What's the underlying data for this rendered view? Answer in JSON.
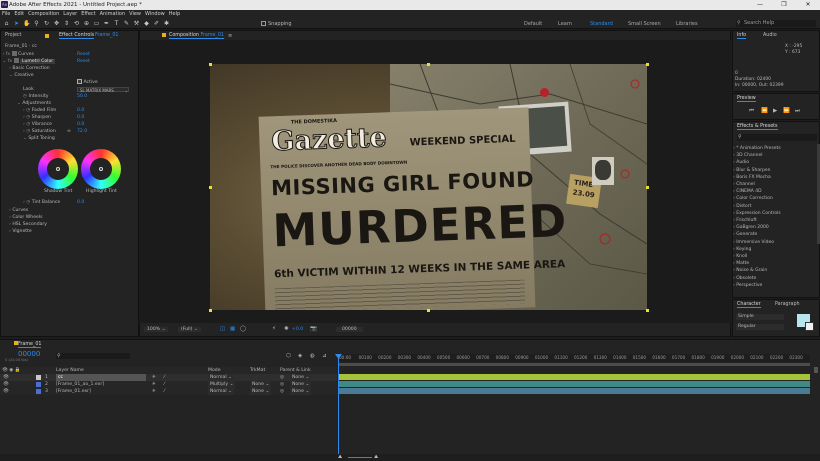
{
  "window": {
    "title": "Adobe After Effects 2021 - Untitled Project.aep *",
    "controls": [
      "—",
      "❐",
      "✕"
    ]
  },
  "menu": [
    "File",
    "Edit",
    "Composition",
    "Layer",
    "Effect",
    "Animation",
    "View",
    "Window",
    "Help"
  ],
  "toolbar": {
    "snapping_label": "Snapping",
    "workspaces": [
      "Default",
      "Learn",
      "Standard",
      "Small Screen",
      "Libraries"
    ],
    "active_workspace": "Standard",
    "search_placeholder": "Search Help"
  },
  "left_panel": {
    "tabs": [
      "Project",
      "Effect Controls"
    ],
    "effect_controls_target": "Frame_01",
    "comp_path": "Frame_01 · cc",
    "effects": [
      {
        "name": "Curves",
        "reset": "Reset"
      },
      {
        "name": "Lumetri Color",
        "reset": "Reset"
      }
    ],
    "sections": {
      "basic_correction": "Basic Correction",
      "creative": "Creative",
      "active_label": "Active",
      "look_label": "Look",
      "look_value": "SL MATRIX MARS",
      "intensity_label": "Intensity",
      "intensity_value": "50.0",
      "adjustments": "Adjustments",
      "faded_film_label": "Faded Film",
      "faded_film_value": "0.0",
      "sharpen_label": "Sharpen",
      "sharpen_value": "0.0",
      "vibrance_label": "Vibrance",
      "vibrance_value": "0.0",
      "saturation_label": "Saturation",
      "saturation_value": "72.0",
      "split_toning": "Split Toning",
      "shadow_tint": "Shadow Tint",
      "highlight_tint": "Highlight Tint",
      "tint_balance_label": "Tint Balance",
      "tint_balance_value": "0.0",
      "curves": "Curves",
      "color_wheels": "Color Wheels",
      "hsl_secondary": "HSL Secondary",
      "vignette": "Vignette"
    }
  },
  "composition": {
    "tab_label": "Composition",
    "tab_name": "Frame_01",
    "sub_tab": "Frame_01",
    "adaptive_resolution": "Adaptive Resolution (1/2)",
    "footer": {
      "zoom": "100%",
      "resolution": "(Full)",
      "exposure": "+0.0",
      "timecode": "00000"
    },
    "newspaper": {
      "masthead_small": "THE DOMESTIKA",
      "masthead": "Gazette",
      "weekend": "WEEKEND SPECIAL",
      "subhead": "THE POLICE DISCOVER ANOTHER DEAD BODY DOWNTOWN",
      "headline1": "MISSING GIRL FOUND",
      "headline2": "MURDERED",
      "footline": "6th VICTIM WITHIN 12 WEEKS IN THE SAME AREA",
      "note_time": "TIME",
      "note_date": "23.09"
    }
  },
  "info_panel": {
    "tabs": [
      "Info",
      "Audio"
    ],
    "x": "X : -295",
    "y": "Y : 673",
    "duration": "Duration: 02400",
    "in_out": "In: 00000, Out: 02399",
    "zero": "0"
  },
  "preview_panel": {
    "title": "Preview"
  },
  "effects_presets": {
    "title": "Effects & Presets",
    "search_placeholder": "",
    "items": [
      "* Animation Presets",
      "3D Channel",
      "Audio",
      "Blur & Sharpen",
      "Boris FX Mocha",
      "Channel",
      "CINEMA 4D",
      "Color Correction",
      "Distort",
      "Expression Controls",
      "Frischluft",
      "GaBgren 2000",
      "Generate",
      "Immersive Video",
      "Keying",
      "Knoll",
      "Matte",
      "Noise & Grain",
      "Obsolete",
      "Perspective"
    ]
  },
  "character_panel": {
    "tabs": [
      "Character",
      "Paragraph"
    ],
    "font_family": "Simple",
    "font_style": "Regular",
    "fill_color": "#b8e4f0"
  },
  "timeline": {
    "tab_label": "Frame_01",
    "timecode": "00000",
    "fps_note": "0 (24.00 fps)",
    "headers": {
      "layer_name": "Layer Name",
      "mode": "Mode",
      "trkmat": "TrkMat",
      "parent": "Parent & Link"
    },
    "layers": [
      {
        "num": "1",
        "name": "cc",
        "mode": "Normal",
        "trkmat": "",
        "parent": "None",
        "color": "#c8c8c8"
      },
      {
        "num": "2",
        "name": "[Frame_01_ao_1.exr]",
        "mode": "Multiply",
        "trkmat": "None",
        "parent": "None",
        "color": "#4a6fd0"
      },
      {
        "num": "3",
        "name": "[Frame_01.exr]",
        "mode": "Normal",
        "trkmat": "None",
        "parent": "None",
        "color": "#4a6fd0"
      }
    ],
    "ruler": [
      "00:00",
      "00100",
      "00200",
      "00300",
      "00400",
      "00500",
      "00600",
      "00700",
      "00800",
      "00900",
      "01000",
      "01100",
      "01200",
      "01300",
      "01400",
      "01500",
      "01600",
      "01700",
      "01800",
      "01900",
      "02000",
      "02100",
      "02200",
      "02300"
    ],
    "track_colors": [
      "#a6c43a",
      "#3f8a84",
      "#4a7a94"
    ]
  }
}
